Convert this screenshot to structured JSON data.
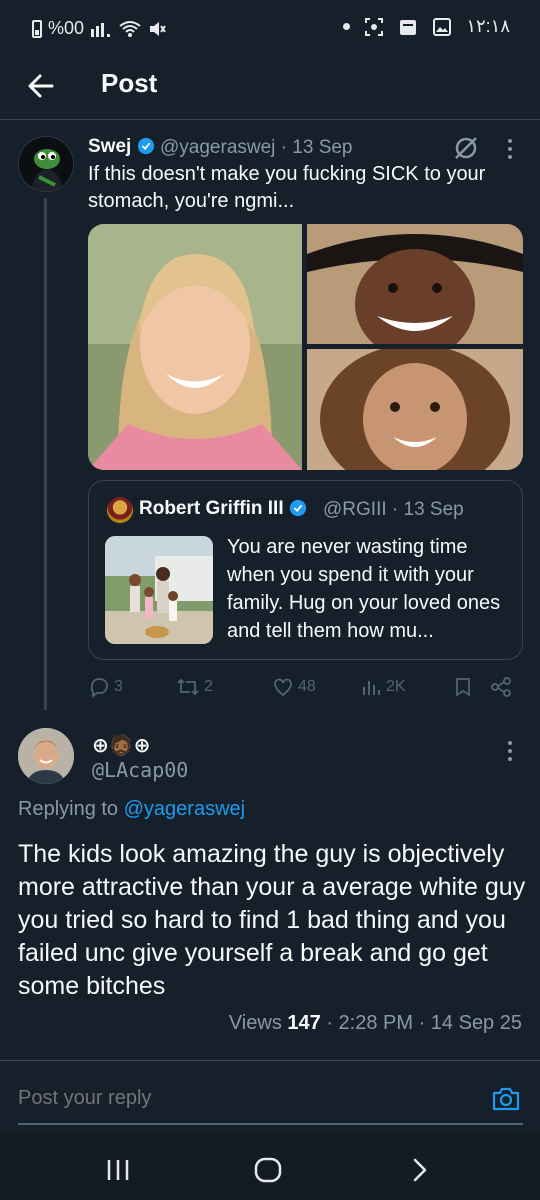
{
  "status_bar": {
    "battery_text": "%00",
    "time": "١٢:١٨"
  },
  "header": {
    "title": "Post"
  },
  "post": {
    "display_name": "Swej",
    "handle_time": "@yageraswej · 13 Sep",
    "text": "If this doesn't make you fucking SICK to your stomach, you're ngmi...",
    "quote": {
      "display_name": "Robert Griffin III",
      "handle_time": "@RGIII · 13 Sep",
      "text": "You are never wasting time when you spend it with your family. Hug on your loved ones and tell them how mu..."
    },
    "actions": {
      "replies": "3",
      "reposts": "2",
      "likes": "48",
      "views": "2K"
    }
  },
  "reply": {
    "display_name": "⊕🧔🏾⊕",
    "handle": "@LAcap00",
    "replying_to_label": "Replying to",
    "replying_to_handle": "@yageraswej",
    "text": "The kids look amazing the guy is objectively more attractive than your a average white guy you tried so hard to find 1 bad thing and you failed unc give yourself a break and go get some bitches",
    "views_label": "Views",
    "views_count": "147",
    "timestamp": " · 2:28 PM · 14 Sep 25"
  },
  "composer": {
    "placeholder": "Post your reply"
  },
  "colors": {
    "background": "#15202b",
    "accent": "#1d9bf0",
    "secondary_text": "#8b98a5"
  },
  "icons": [
    "arrow-left-icon",
    "verified-badge-icon",
    "grok-icon",
    "more-vertical-icon",
    "reply-icon",
    "repost-icon",
    "like-icon",
    "views-icon",
    "bookmark-icon",
    "share-icon",
    "camera-icon",
    "recent-apps-icon",
    "home-icon",
    "back-chevron-icon"
  ]
}
